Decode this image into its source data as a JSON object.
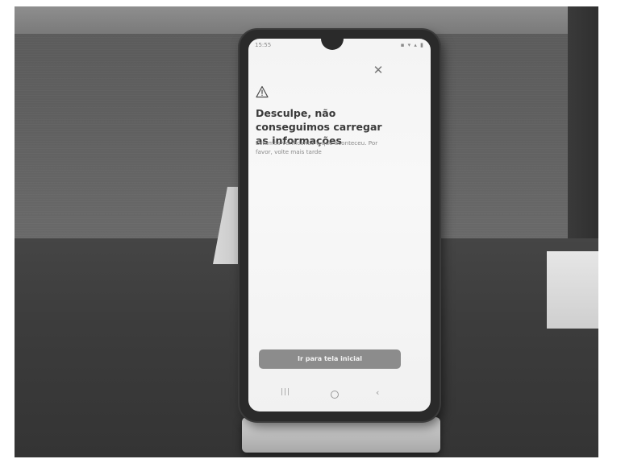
{
  "status_bar": {
    "time": "15:55",
    "notification_icons": "▲ ▪",
    "system_icons": "▪ ▾ ▴ ▮"
  },
  "error_screen": {
    "close_icon": "close-icon",
    "warning_icon": "warning-triangle-icon",
    "title": "Desculpe, não conseguimos carregar as informações",
    "message": "Estamos verificando o que aconteceu. Por favor, volte mais tarde",
    "primary_button_label": "Ir para tela inicial"
  },
  "nav_bar": {
    "recents_glyph": "|||",
    "home_glyph": "○",
    "back_glyph": "‹"
  },
  "colors": {
    "screen_background": "#f4f4f4",
    "title_text": "#3a3a3a",
    "body_text": "#8a8a8a",
    "button_background": "#8c8c8c",
    "button_text": "#f3f3f3",
    "phone_frame": "#2a2a2a"
  }
}
